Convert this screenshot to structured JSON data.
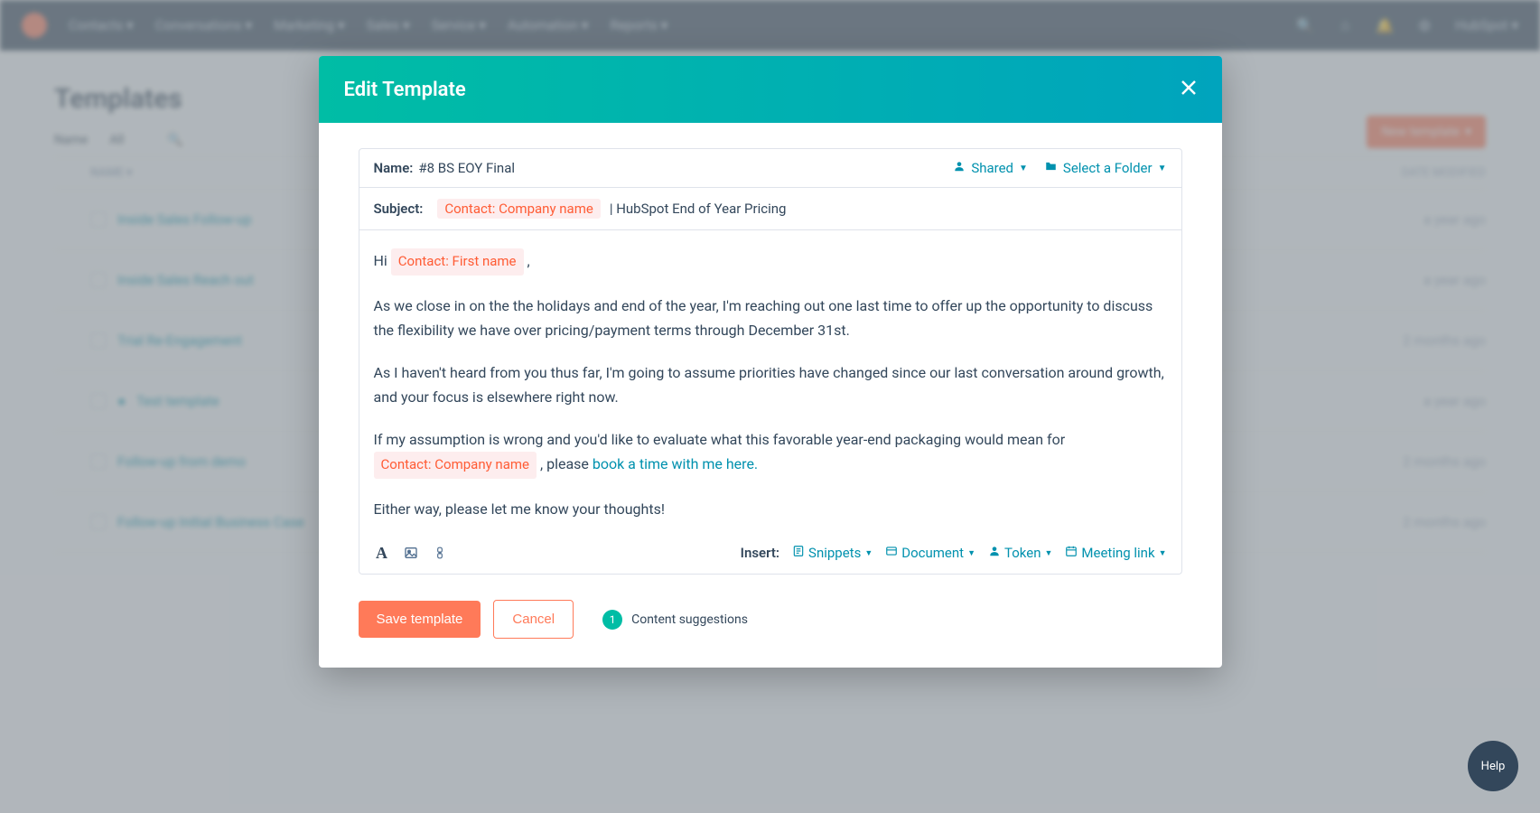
{
  "nav": {
    "items": [
      "Contacts",
      "Conversations",
      "Marketing",
      "Sales",
      "Service",
      "Automation",
      "Reports"
    ],
    "account": "HubSpot"
  },
  "page": {
    "title": "Templates",
    "new_button": "New template",
    "tabs": {
      "a": "Name",
      "b": "All"
    },
    "col_date": "DATE MODIFIED",
    "rows": [
      {
        "name": "Inside Sales Follow-up",
        "date": "a year ago"
      },
      {
        "name": "Inside Sales Reach out",
        "date": "a year ago"
      },
      {
        "name": "Trial Re-Engagement",
        "date": "2 months ago"
      },
      {
        "name": "Test template",
        "date": "a year ago"
      },
      {
        "name": "Follow-up from demo",
        "date": "2 months ago"
      },
      {
        "name": "Follow-up Initial Business Case",
        "date": "2 months ago"
      }
    ]
  },
  "modal": {
    "title": "Edit Template",
    "name_label": "Name:",
    "name_value": "#8 BS EOY Final",
    "shared": "Shared",
    "folder": "Select a Folder",
    "subject_label": "Subject:",
    "subject_token": "Contact: Company name",
    "subject_after": "| HubSpot End of Year Pricing",
    "body": {
      "greeting_pre": "Hi ",
      "greeting_token": "Contact: First name",
      "greeting_post": " ,",
      "p1": "As we close in on the the holidays and end of the year, I'm reaching out one last time to offer up the opportunity to discuss the flexibility we have over pricing/payment terms through December 31st.",
      "p2": "As I haven't heard from you thus far, I'm going to assume priorities have changed since our last conversation around growth, and your focus is elsewhere right now.",
      "p3_pre": "If my assumption is wrong and you'd like to evaluate what this favorable year-end packaging would mean for ",
      "p3_token": "Contact: Company name",
      "p3_mid": " , please ",
      "p3_link": "book a time with me here.",
      "p4": "Either way, please let me know your thoughts!"
    },
    "toolbar": {
      "insert_label": "Insert:",
      "snippets": "Snippets",
      "document": "Document",
      "token": "Token",
      "meeting": "Meeting link"
    },
    "save": "Save template",
    "cancel": "Cancel",
    "suggestions_count": "1",
    "suggestions_label": "Content suggestions"
  },
  "help": "Help"
}
